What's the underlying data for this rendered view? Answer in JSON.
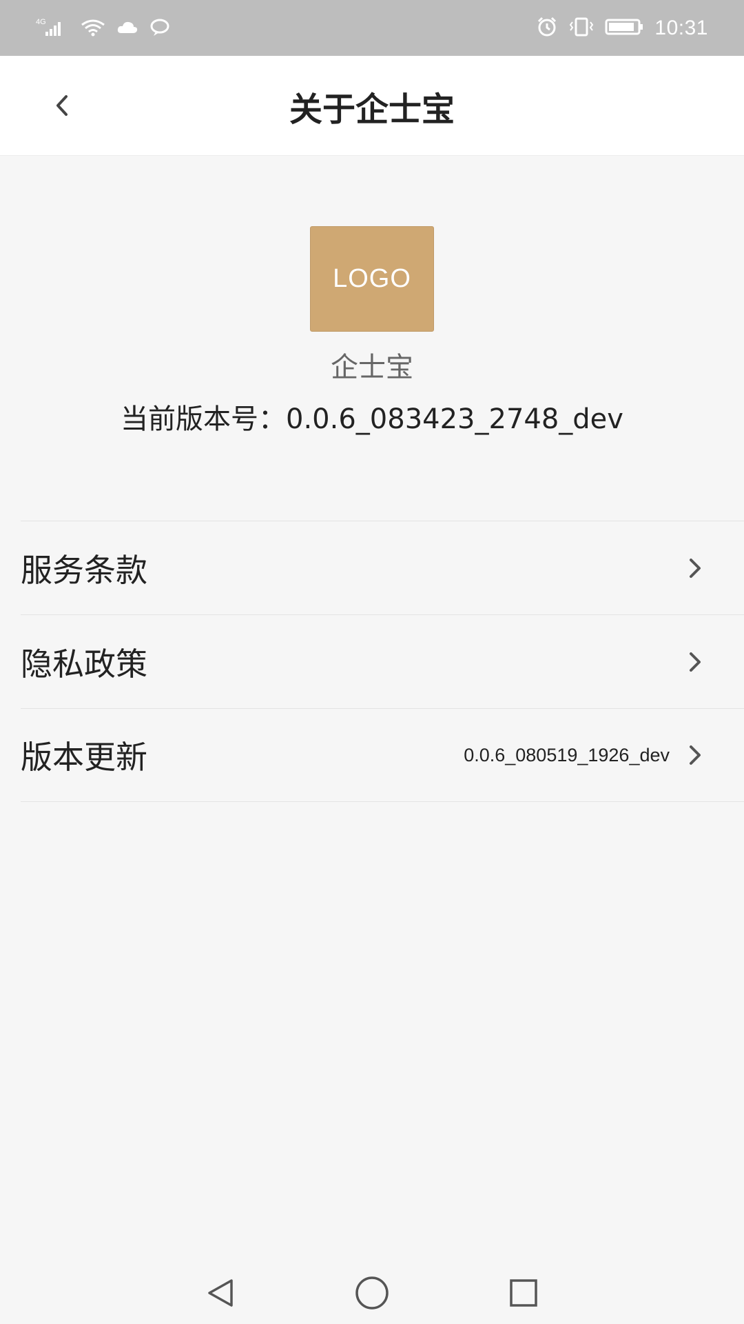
{
  "status_bar": {
    "network_type": "4G",
    "time": "10:31",
    "icons": [
      "signal-icon",
      "wifi-icon",
      "cloud-icon",
      "chat-icon",
      "alarm-icon",
      "vibrate-icon",
      "battery-icon"
    ]
  },
  "header": {
    "title": "关于企士宝"
  },
  "app_info": {
    "logo_text": "LOGO",
    "app_name": "企士宝",
    "version_label": "当前版本号：",
    "version": "0.0.6_083423_2748_dev"
  },
  "menu": {
    "items": [
      {
        "label": "服务条款",
        "value": ""
      },
      {
        "label": "隐私政策",
        "value": ""
      },
      {
        "label": "版本更新",
        "value": "0.0.6_080519_1926_dev"
      }
    ]
  },
  "bottom_nav": {
    "icons": [
      "back-triangle-icon",
      "home-circle-icon",
      "recents-square-icon"
    ]
  },
  "colors": {
    "status_bar": "#bdbdbd",
    "logo_bg": "#cfa873",
    "page_bg": "#f6f6f6"
  }
}
